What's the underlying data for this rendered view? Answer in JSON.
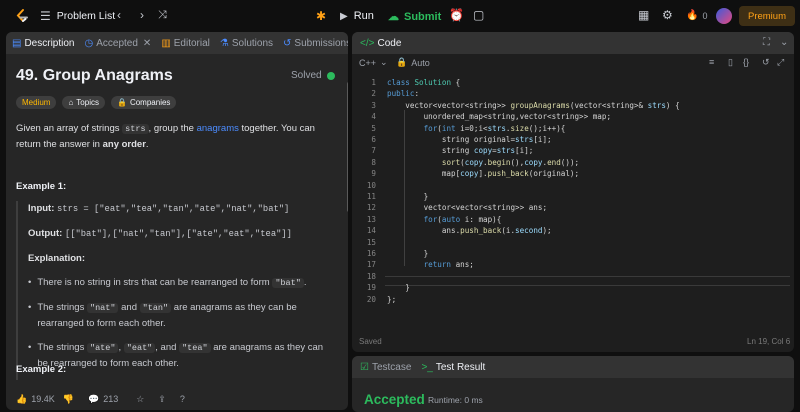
{
  "topbar": {
    "problem_list": "Problem List",
    "run": "Run",
    "submit": "Submit",
    "streak": "0",
    "premium": "Premium",
    "colors": {
      "submit": "#2cbb5d",
      "premium": "#ffa116"
    }
  },
  "left_tabs": [
    {
      "label": "Description",
      "icon": "description-icon",
      "active": true
    },
    {
      "label": "Accepted",
      "icon": "clock-icon"
    },
    {
      "label": "Editorial",
      "icon": "book-icon"
    },
    {
      "label": "Solutions",
      "icon": "flask-icon"
    },
    {
      "label": "Submissions",
      "icon": "history-icon"
    }
  ],
  "problem": {
    "title": "49. Group Anagrams",
    "status": "Solved",
    "difficulty": "Medium",
    "topics": "Topics",
    "companies": "Companies",
    "desc_1": "Given an array of strings ",
    "desc_code": "strs",
    "desc_2": ", group the ",
    "desc_link": "anagrams",
    "desc_3": " together. You can return the answer in ",
    "desc_bold": "any order",
    "desc_4": "."
  },
  "example1": {
    "heading": "Example 1:",
    "input_label": "Input:",
    "input_value": "strs = [\"eat\",\"tea\",\"tan\",\"ate\",\"nat\",\"bat\"]",
    "output_label": "Output:",
    "output_value": "[[\"bat\"],[\"nat\",\"tan\"],[\"ate\",\"eat\",\"tea\"]]",
    "explanation_label": "Explanation:",
    "b1_text": "There is no string in strs that can be rearranged to form ",
    "b1_code": "\"bat\"",
    "b1_end": ".",
    "b2_1": "The strings ",
    "b2_c1": "\"nat\"",
    "b2_2": " and ",
    "b2_c2": "\"tan\"",
    "b2_3": " are anagrams as they can be rearranged to form each other.",
    "b3_1": "The strings ",
    "b3_c1": "\"ate\"",
    "b3_2": ", ",
    "b3_c2": "\"eat\"",
    "b3_3": ", and ",
    "b3_c3": "\"tea\"",
    "b3_4": " are anagrams as they can be rearranged to form each other."
  },
  "example2": {
    "heading": "Example 2:"
  },
  "footer_left": {
    "likes": "19.4K",
    "comments": "213"
  },
  "code_panel": {
    "title": "Code",
    "language": "C++",
    "autocomplete": "Auto",
    "saved": "Saved",
    "cursor": "Ln 19, Col 6",
    "lines": [
      "class Solution {",
      "public:",
      "    vector<vector<string>> groupAnagrams(vector<string>& strs) {",
      "        unordered_map<string,vector<string>> map;",
      "        for(int i=0;i<strs.size();i++){",
      "            string original=strs[i];",
      "            string copy=strs[i];",
      "            sort(copy.begin(),copy.end());",
      "            map[copy].push_back(original);",
      "",
      "        }",
      "        vector<vector<string>> ans;",
      "        for(auto i: map){",
      "            ans.push_back(i.second);",
      "",
      "        }",
      "        return ans;",
      "",
      "    }",
      "};"
    ]
  },
  "test_panel": {
    "testcase": "Testcase",
    "test_result": "Test Result",
    "result": "Accepted",
    "runtime": "Runtime: 0 ms"
  }
}
